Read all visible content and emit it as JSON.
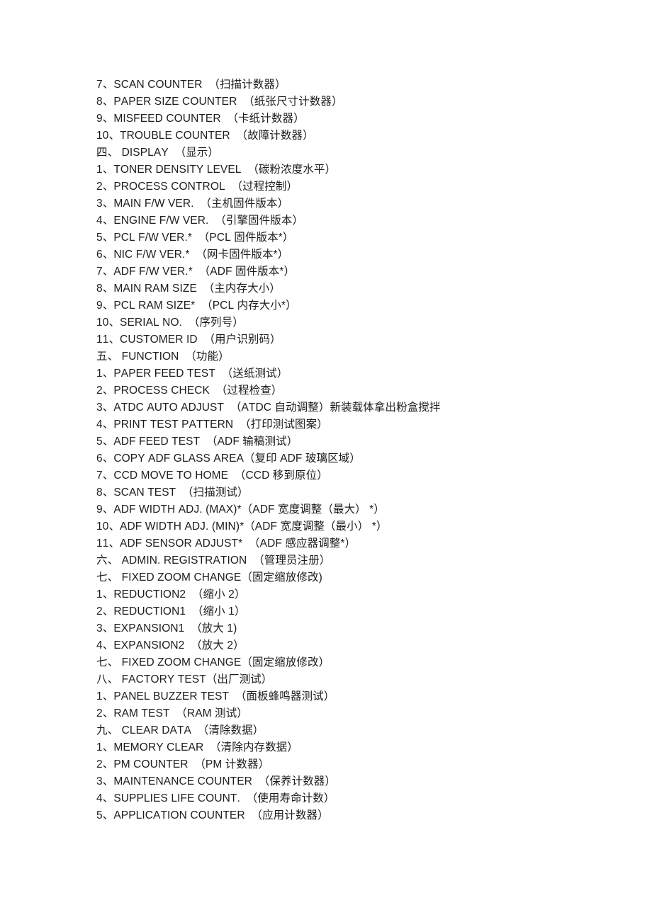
{
  "document": {
    "page_background": "#ffffff",
    "text_color": "#1c1c1c",
    "lines": [
      {
        "id": "scan-counter",
        "type": "item",
        "text": "7、SCAN COUNTER  （扫描计数器）"
      },
      {
        "id": "paper-size-counter",
        "type": "item",
        "text": "8、PAPER SIZE COUNTER  （纸张尺寸计数器）"
      },
      {
        "id": "misfeed-counter",
        "type": "item",
        "text": "9、MISFEED COUNTER  （卡纸计数器）"
      },
      {
        "id": "trouble-counter",
        "type": "item",
        "text": "10、TROUBLE COUNTER  （故障计数器）"
      },
      {
        "id": "section-display",
        "type": "section",
        "text": "四、 DISPLAY  （显示）"
      },
      {
        "id": "toner-density-level",
        "type": "item",
        "text": "1、TONER DENSITY LEVEL  （碳粉浓度水平）"
      },
      {
        "id": "process-control",
        "type": "item",
        "text": "2、PROCESS CONTROL  （过程控制）"
      },
      {
        "id": "main-fw-ver",
        "type": "item",
        "text": "3、MAIN F/W VER.  （主机固件版本）"
      },
      {
        "id": "engine-fw-ver",
        "type": "item",
        "text": "4、ENGINE F/W VER.  （引擎固件版本）"
      },
      {
        "id": "pcl-fw-ver",
        "type": "item",
        "text": "5、PCL F/W VER.*  （PCL 固件版本*）"
      },
      {
        "id": "nic-fw-ver",
        "type": "item",
        "text": "6、NIC F/W VER.*  （网卡固件版本*）"
      },
      {
        "id": "adf-fw-ver",
        "type": "item",
        "text": "7、ADF F/W VER.*  （ADF 固件版本*）"
      },
      {
        "id": "main-ram-size",
        "type": "item",
        "text": "8、MAIN RAM SIZE  （主内存大小）"
      },
      {
        "id": "pcl-ram-size",
        "type": "item",
        "text": "9、PCL RAM SIZE*  （PCL 内存大小*）"
      },
      {
        "id": "serial-no",
        "type": "item",
        "text": "10、SERIAL NO.  （序列号）"
      },
      {
        "id": "customer-id",
        "type": "item",
        "text": "11、CUSTOMER ID  （用户识别码）"
      },
      {
        "id": "section-function",
        "type": "section",
        "text": "五、 FUNCTION  （功能）"
      },
      {
        "id": "paper-feed-test",
        "type": "item",
        "text": "1、PAPER FEED TEST  （送纸测试）"
      },
      {
        "id": "process-check",
        "type": "item",
        "text": "2、PROCESS CHECK  （过程检查）"
      },
      {
        "id": "atdc-auto-adjust",
        "type": "item",
        "text": "3、ATDC AUTO ADJUST  （ATDC 自动调整）新装载体拿出粉盒搅拌"
      },
      {
        "id": "print-test-pattern",
        "type": "item",
        "text": "4、PRINT TEST PATTERN  （打印测试图案）"
      },
      {
        "id": "adf-feed-test",
        "type": "item",
        "text": "5、ADF FEED TEST  （ADF 输稿测试）"
      },
      {
        "id": "copy-adf-glass-area",
        "type": "item",
        "text": "6、COPY ADF GLASS AREA（复印 ADF 玻璃区域）"
      },
      {
        "id": "ccd-move-to-home",
        "type": "item",
        "text": "7、CCD MOVE TO HOME  （CCD 移到原位）"
      },
      {
        "id": "scan-test",
        "type": "item",
        "text": "8、SCAN TEST  （扫描测试）"
      },
      {
        "id": "adf-width-adj-max",
        "type": "item",
        "text": "9、ADF WIDTH ADJ. (MAX)*（ADF 宽度调整（最大） *）"
      },
      {
        "id": "adf-width-adj-min",
        "type": "item",
        "text": "10、ADF WIDTH ADJ. (MIN)*（ADF 宽度调整（最小） *）"
      },
      {
        "id": "adf-sensor-adjust",
        "type": "item",
        "text": "11、ADF SENSOR ADJUST*  （ADF 感应器调整*）"
      },
      {
        "id": "section-admin-reg",
        "type": "section",
        "text": "六、 ADMIN. REGISTRATION  （管理员注册）"
      },
      {
        "id": "section-fixed-zoom-1",
        "type": "section",
        "text": "七、 FIXED ZOOM CHANGE（固定缩放修改)"
      },
      {
        "id": "reduction2",
        "type": "item",
        "text": "1、REDUCTION2  （缩小 2）"
      },
      {
        "id": "reduction1",
        "type": "item",
        "text": "2、REDUCTION1  （缩小 1）"
      },
      {
        "id": "expansion1",
        "type": "item",
        "text": "3、EXPANSION1  （放大 1)"
      },
      {
        "id": "expansion2",
        "type": "item",
        "text": "4、EXPANSION2  （放大 2）"
      },
      {
        "id": "section-fixed-zoom-2",
        "type": "section",
        "text": "七、 FIXED ZOOM CHANGE（固定缩放修改）"
      },
      {
        "id": "section-factory-test",
        "type": "section",
        "text": "八、 FACTORY TEST（出厂测试）"
      },
      {
        "id": "panel-buzzer-test",
        "type": "item",
        "text": "1、PANEL BUZZER TEST  （面板蜂鸣器测试）"
      },
      {
        "id": "ram-test",
        "type": "item",
        "text": "2、RAM TEST  （RAM 测试）"
      },
      {
        "id": "section-clear-data",
        "type": "section",
        "text": "九、 CLEAR DATA  （清除数据）"
      },
      {
        "id": "memory-clear",
        "type": "item",
        "text": "1、MEMORY CLEAR  （清除内存数据）"
      },
      {
        "id": "pm-counter",
        "type": "item",
        "text": "2、PM COUNTER  （PM 计数器）"
      },
      {
        "id": "maintenance-counter",
        "type": "item",
        "text": "3、MAINTENANCE COUNTER  （保养计数器）"
      },
      {
        "id": "supplies-life-count",
        "type": "item",
        "text": "4、SUPPLIES LIFE COUNT.  （使用寿命计数）"
      },
      {
        "id": "application-counter",
        "type": "item",
        "text": "5、APPLICATION COUNTER  （应用计数器）"
      }
    ]
  }
}
